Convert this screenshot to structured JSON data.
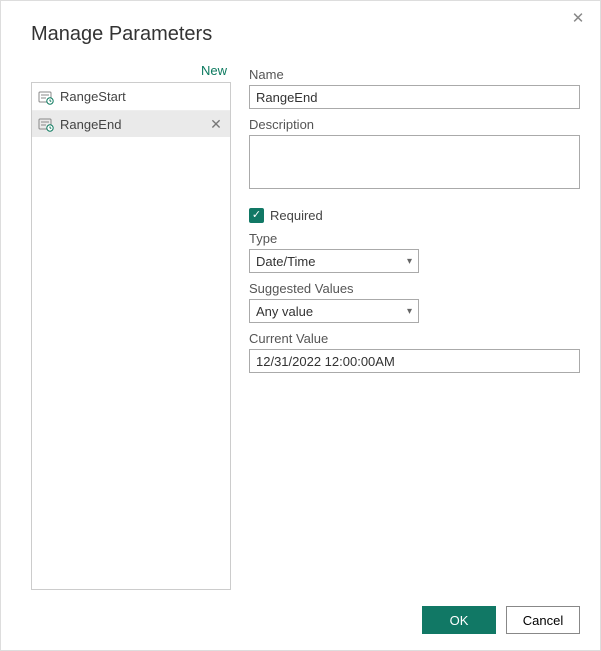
{
  "dialog": {
    "title": "Manage Parameters"
  },
  "sidebar": {
    "new_label": "New",
    "items": [
      {
        "label": "RangeStart"
      },
      {
        "label": "RangeEnd"
      }
    ],
    "selected_index": 1
  },
  "form": {
    "name_label": "Name",
    "name_value": "RangeEnd",
    "description_label": "Description",
    "description_value": "",
    "required_checked": true,
    "required_label": "Required",
    "type_label": "Type",
    "type_value": "Date/Time",
    "suggested_label": "Suggested Values",
    "suggested_value": "Any value",
    "current_value_label": "Current Value",
    "current_value": "12/31/2022 12:00:00AM"
  },
  "buttons": {
    "ok": "OK",
    "cancel": "Cancel"
  },
  "icons": {
    "close": "✕",
    "check": "✓",
    "chevron_down": "▾",
    "delete": "✕"
  }
}
